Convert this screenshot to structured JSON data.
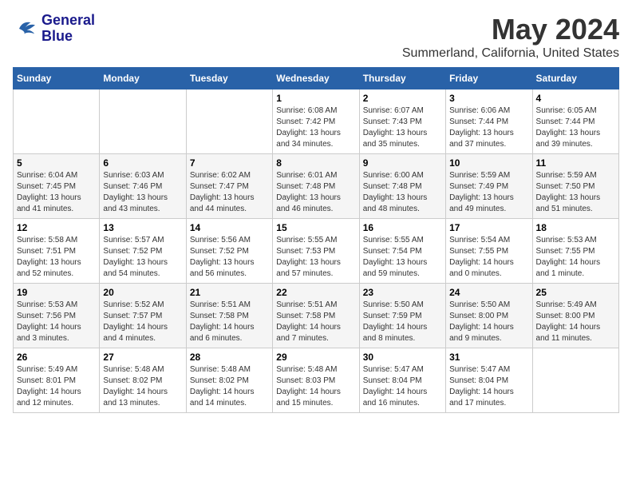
{
  "logo": {
    "text_line1": "General",
    "text_line2": "Blue"
  },
  "header": {
    "month": "May 2024",
    "location": "Summerland, California, United States"
  },
  "weekdays": [
    "Sunday",
    "Monday",
    "Tuesday",
    "Wednesday",
    "Thursday",
    "Friday",
    "Saturday"
  ],
  "weeks": [
    [
      {
        "day": "",
        "info": ""
      },
      {
        "day": "",
        "info": ""
      },
      {
        "day": "",
        "info": ""
      },
      {
        "day": "1",
        "info": "Sunrise: 6:08 AM\nSunset: 7:42 PM\nDaylight: 13 hours\nand 34 minutes."
      },
      {
        "day": "2",
        "info": "Sunrise: 6:07 AM\nSunset: 7:43 PM\nDaylight: 13 hours\nand 35 minutes."
      },
      {
        "day": "3",
        "info": "Sunrise: 6:06 AM\nSunset: 7:44 PM\nDaylight: 13 hours\nand 37 minutes."
      },
      {
        "day": "4",
        "info": "Sunrise: 6:05 AM\nSunset: 7:44 PM\nDaylight: 13 hours\nand 39 minutes."
      }
    ],
    [
      {
        "day": "5",
        "info": "Sunrise: 6:04 AM\nSunset: 7:45 PM\nDaylight: 13 hours\nand 41 minutes."
      },
      {
        "day": "6",
        "info": "Sunrise: 6:03 AM\nSunset: 7:46 PM\nDaylight: 13 hours\nand 43 minutes."
      },
      {
        "day": "7",
        "info": "Sunrise: 6:02 AM\nSunset: 7:47 PM\nDaylight: 13 hours\nand 44 minutes."
      },
      {
        "day": "8",
        "info": "Sunrise: 6:01 AM\nSunset: 7:48 PM\nDaylight: 13 hours\nand 46 minutes."
      },
      {
        "day": "9",
        "info": "Sunrise: 6:00 AM\nSunset: 7:48 PM\nDaylight: 13 hours\nand 48 minutes."
      },
      {
        "day": "10",
        "info": "Sunrise: 5:59 AM\nSunset: 7:49 PM\nDaylight: 13 hours\nand 49 minutes."
      },
      {
        "day": "11",
        "info": "Sunrise: 5:59 AM\nSunset: 7:50 PM\nDaylight: 13 hours\nand 51 minutes."
      }
    ],
    [
      {
        "day": "12",
        "info": "Sunrise: 5:58 AM\nSunset: 7:51 PM\nDaylight: 13 hours\nand 52 minutes."
      },
      {
        "day": "13",
        "info": "Sunrise: 5:57 AM\nSunset: 7:52 PM\nDaylight: 13 hours\nand 54 minutes."
      },
      {
        "day": "14",
        "info": "Sunrise: 5:56 AM\nSunset: 7:52 PM\nDaylight: 13 hours\nand 56 minutes."
      },
      {
        "day": "15",
        "info": "Sunrise: 5:55 AM\nSunset: 7:53 PM\nDaylight: 13 hours\nand 57 minutes."
      },
      {
        "day": "16",
        "info": "Sunrise: 5:55 AM\nSunset: 7:54 PM\nDaylight: 13 hours\nand 59 minutes."
      },
      {
        "day": "17",
        "info": "Sunrise: 5:54 AM\nSunset: 7:55 PM\nDaylight: 14 hours\nand 0 minutes."
      },
      {
        "day": "18",
        "info": "Sunrise: 5:53 AM\nSunset: 7:55 PM\nDaylight: 14 hours\nand 1 minute."
      }
    ],
    [
      {
        "day": "19",
        "info": "Sunrise: 5:53 AM\nSunset: 7:56 PM\nDaylight: 14 hours\nand 3 minutes."
      },
      {
        "day": "20",
        "info": "Sunrise: 5:52 AM\nSunset: 7:57 PM\nDaylight: 14 hours\nand 4 minutes."
      },
      {
        "day": "21",
        "info": "Sunrise: 5:51 AM\nSunset: 7:58 PM\nDaylight: 14 hours\nand 6 minutes."
      },
      {
        "day": "22",
        "info": "Sunrise: 5:51 AM\nSunset: 7:58 PM\nDaylight: 14 hours\nand 7 minutes."
      },
      {
        "day": "23",
        "info": "Sunrise: 5:50 AM\nSunset: 7:59 PM\nDaylight: 14 hours\nand 8 minutes."
      },
      {
        "day": "24",
        "info": "Sunrise: 5:50 AM\nSunset: 8:00 PM\nDaylight: 14 hours\nand 9 minutes."
      },
      {
        "day": "25",
        "info": "Sunrise: 5:49 AM\nSunset: 8:00 PM\nDaylight: 14 hours\nand 11 minutes."
      }
    ],
    [
      {
        "day": "26",
        "info": "Sunrise: 5:49 AM\nSunset: 8:01 PM\nDaylight: 14 hours\nand 12 minutes."
      },
      {
        "day": "27",
        "info": "Sunrise: 5:48 AM\nSunset: 8:02 PM\nDaylight: 14 hours\nand 13 minutes."
      },
      {
        "day": "28",
        "info": "Sunrise: 5:48 AM\nSunset: 8:02 PM\nDaylight: 14 hours\nand 14 minutes."
      },
      {
        "day": "29",
        "info": "Sunrise: 5:48 AM\nSunset: 8:03 PM\nDaylight: 14 hours\nand 15 minutes."
      },
      {
        "day": "30",
        "info": "Sunrise: 5:47 AM\nSunset: 8:04 PM\nDaylight: 14 hours\nand 16 minutes."
      },
      {
        "day": "31",
        "info": "Sunrise: 5:47 AM\nSunset: 8:04 PM\nDaylight: 14 hours\nand 17 minutes."
      },
      {
        "day": "",
        "info": ""
      }
    ]
  ]
}
